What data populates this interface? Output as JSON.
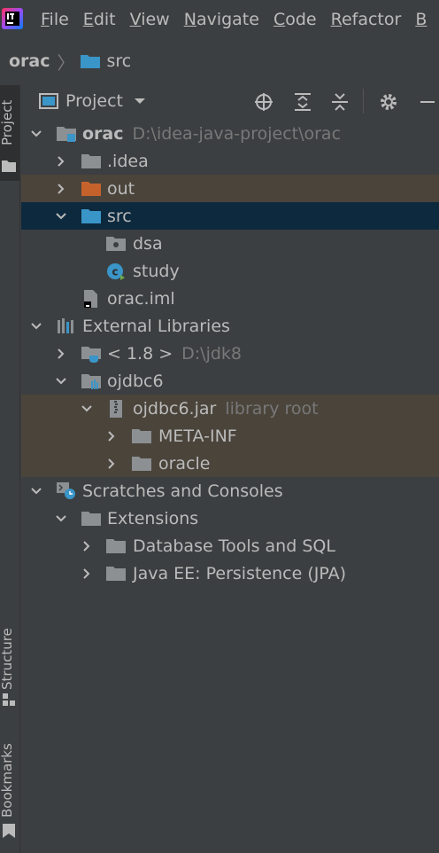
{
  "menu": {
    "items": [
      {
        "label": "File",
        "mnemonic": "F",
        "rest": "ile"
      },
      {
        "label": "Edit",
        "mnemonic": "E",
        "rest": "dit"
      },
      {
        "label": "View",
        "mnemonic": "V",
        "rest": "iew"
      },
      {
        "label": "Navigate",
        "mnemonic": "N",
        "rest": "avigate"
      },
      {
        "label": "Code",
        "mnemonic": "C",
        "rest": "ode"
      },
      {
        "label": "Refactor",
        "mnemonic": "R",
        "rest": "efactor"
      },
      {
        "label": "B",
        "mnemonic": "B",
        "rest": ""
      }
    ]
  },
  "breadcrumb": {
    "root": "orac",
    "child": "src"
  },
  "left_strip": {
    "project": "Project",
    "structure": "Structure",
    "bookmarks": "Bookmarks"
  },
  "panel": {
    "title": "Project"
  },
  "tree": {
    "root": {
      "name": "orac",
      "path": "D:\\idea-java-project\\orac"
    },
    "idea": ".idea",
    "out": "out",
    "src": "src",
    "dsa": "dsa",
    "study": "study",
    "iml": "orac.iml",
    "ext_libs": "External Libraries",
    "jdk": {
      "name": "< 1.8 >",
      "path": "D:\\jdk8"
    },
    "ojdbc": "ojdbc6",
    "jar": {
      "name": "ojdbc6.jar",
      "note": "library root"
    },
    "meta_inf": "META-INF",
    "oracle": "oracle",
    "scratches": "Scratches and Consoles",
    "extensions": "Extensions",
    "db_tools": "Database Tools and SQL",
    "java_ee": "Java EE: Persistence (JPA)"
  },
  "colors": {
    "background": "#3c3f41",
    "selection": "#0d293e",
    "library_highlight": "#4a443b",
    "folder_gray": "#8c9093",
    "folder_blue": "#3a95c8",
    "folder_orange": "#c5622b"
  }
}
